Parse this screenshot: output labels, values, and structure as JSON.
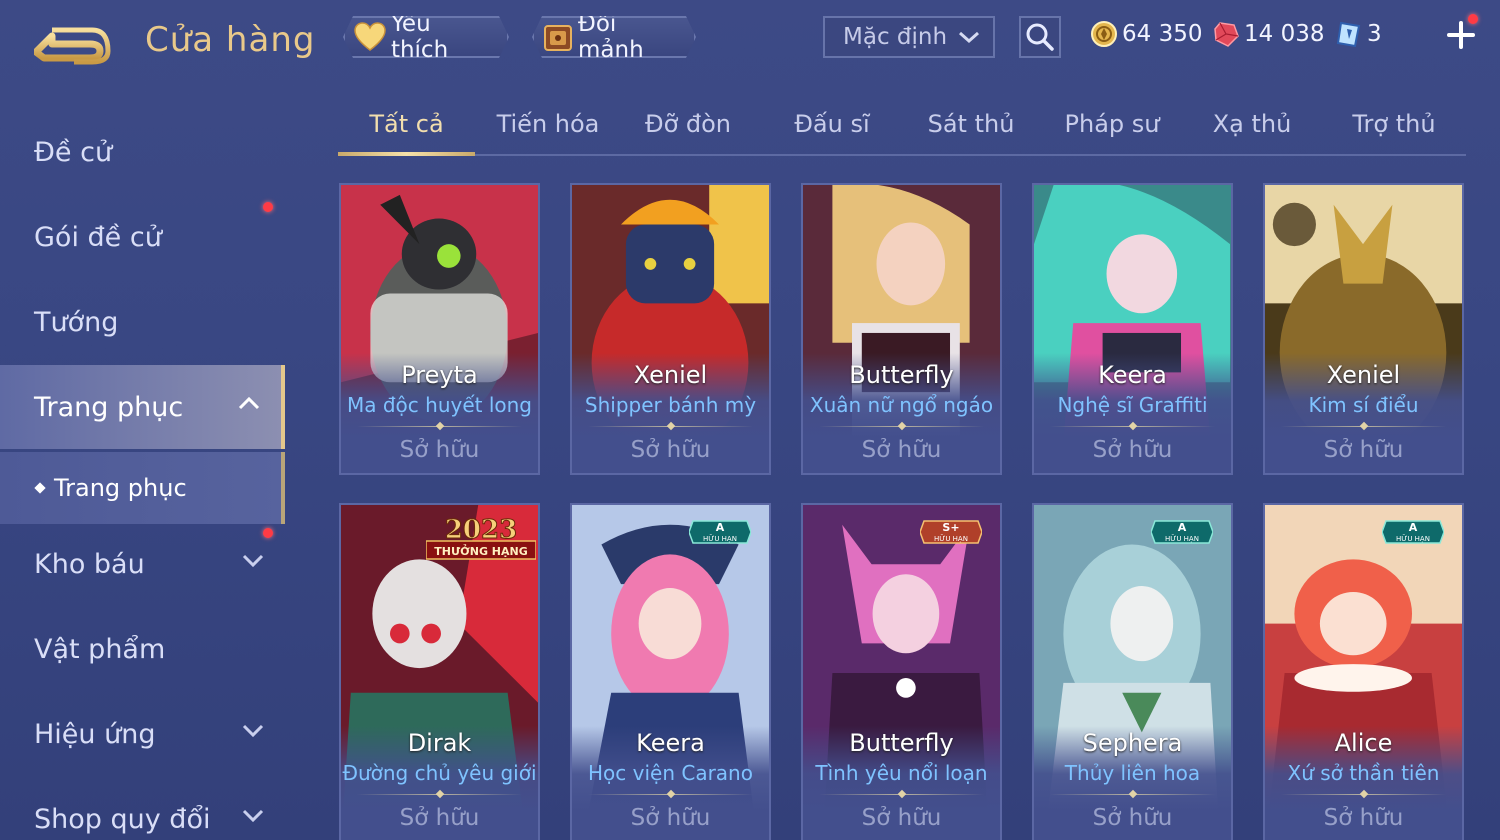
{
  "header": {
    "title": "Cửa hàng",
    "favorite_label": "Yêu thích",
    "exchange_label": "Đổi mảnh",
    "sort_value": "Mặc định"
  },
  "currencies": {
    "gold": "64 350",
    "ruby": "14 038",
    "voucher": "3"
  },
  "sidebar": {
    "items": [
      {
        "label": "Đề cử"
      },
      {
        "label": "Gói đề cử"
      },
      {
        "label": "Tướng"
      },
      {
        "label": "Trang phục"
      },
      {
        "label": "Kho báu"
      },
      {
        "label": "Vật phẩm"
      },
      {
        "label": "Hiệu ứng"
      },
      {
        "label": "Shop quy đổi"
      }
    ],
    "sub_item": "Trang phục"
  },
  "tabs": [
    "Tất cả",
    "Tiến hóa",
    "Đỡ đòn",
    "Đấu sĩ",
    "Sát thủ",
    "Pháp sư",
    "Xạ thủ",
    "Trợ thủ"
  ],
  "cards": [
    {
      "hero": "Preyta",
      "skin": "Ma độc huyết long",
      "status": "Sở hữu"
    },
    {
      "hero": "Xeniel",
      "skin": "Shipper bánh mỳ",
      "status": "Sở hữu"
    },
    {
      "hero": "Butterfly",
      "skin": "Xuân nữ ngổ ngáo",
      "status": "Sở hữu"
    },
    {
      "hero": "Keera",
      "skin": "Nghệ sĩ Graffiti",
      "status": "Sở hữu"
    },
    {
      "hero": "Xeniel",
      "skin": "Kim sí điểu",
      "status": "Sở hữu"
    },
    {
      "hero": "Dirak",
      "skin": "Đường chủ yêu giới",
      "status": "Sở hữu",
      "badge_year": "2023",
      "badge_text": "THƯỞNG HẠNG"
    },
    {
      "hero": "Keera",
      "skin": "Học viện Carano",
      "status": "Sở hữu",
      "tier": "A",
      "tier_text": "HỮU HẠN"
    },
    {
      "hero": "Butterfly",
      "skin": "Tình yêu nổi loạn",
      "status": "Sở hữu",
      "tier": "S+",
      "tier_text": "HỮU HẠN"
    },
    {
      "hero": "Sephera",
      "skin": "Thủy liên hoa",
      "status": "Sở hữu",
      "tier": "A",
      "tier_text": "HỮU HẠN"
    },
    {
      "hero": "Alice",
      "skin": "Xứ sở thần tiên",
      "status": "Sở hữu",
      "tier": "A",
      "tier_text": "HỮU HẠN"
    }
  ],
  "colors": {
    "accent_gold": "#e9c98a",
    "skin_blue": "#7fc3ff",
    "notification_red": "#ff3b45"
  }
}
